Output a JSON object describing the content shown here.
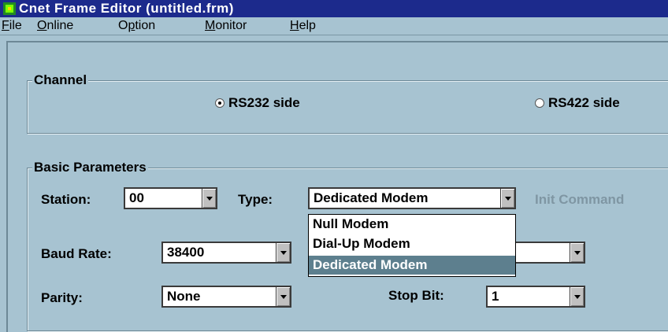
{
  "window": {
    "title": "Cnet Frame Editor (untitled.frm)"
  },
  "menu": [
    {
      "pre": "",
      "key": "F",
      "post": "ile"
    },
    {
      "pre": "",
      "key": "O",
      "post": "nline"
    },
    {
      "pre": "O",
      "key": "p",
      "post": "tion"
    },
    {
      "pre": "",
      "key": "M",
      "post": "onitor"
    },
    {
      "pre": "",
      "key": "H",
      "post": "elp"
    }
  ],
  "channel": {
    "title": "Channel",
    "rs232_label": "RS232 side",
    "rs422_label": "RS422 side",
    "selected": "RS232 side"
  },
  "basic": {
    "title": "Basic Parameters",
    "station_label": "Station:",
    "station_value": "00",
    "type_label": "Type:",
    "type_value": "Dedicated Modem",
    "init_command_label": "Init Command",
    "baud_label": "Baud Rate:",
    "baud_value": "38400",
    "parity_label": "Parity:",
    "parity_value": "None",
    "stopbit_label": "Stop Bit:",
    "stopbit_value": "1",
    "type_options": [
      "Null Modem",
      "Dial-Up Modem",
      "Dedicated Modem"
    ],
    "type_highlighted": "Dedicated Modem"
  }
}
